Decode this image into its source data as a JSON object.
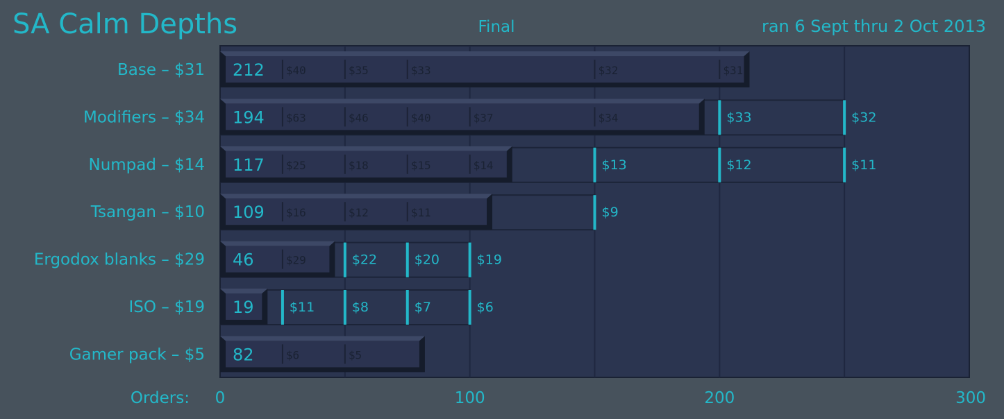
{
  "header": {
    "title": "SA Calm Depths",
    "subtitle": "Final",
    "date_range": "ran 6 Sept thru 2 Oct 2013"
  },
  "colors": {
    "background": "#47525c",
    "plot_background": "#2b3550",
    "accent": "#23b8c9",
    "bar_face": "#2b3350",
    "bar_bevel_top": "#3d4866",
    "bar_shadow": "#151c2b",
    "grid": "#1f2740"
  },
  "chart_data": {
    "type": "bar",
    "orientation": "horizontal",
    "title": "SA Calm Depths",
    "subtitle": "Final",
    "xlabel": "Orders:",
    "xlim": [
      0,
      300
    ],
    "xticks": [
      0,
      100,
      200,
      300
    ],
    "grid": true,
    "categories": [
      "Base – $31",
      "Modifiers – $34",
      "Numpad – $14",
      "Tsangan – $10",
      "Ergodox blanks – $29",
      "ISO – $19",
      "Gamer pack – $5"
    ],
    "values": [
      212,
      194,
      117,
      109,
      46,
      19,
      82
    ],
    "price_tiers": [
      [
        {
          "orders": 25,
          "price": "$40"
        },
        {
          "orders": 50,
          "price": "$35"
        },
        {
          "orders": 75,
          "price": "$33"
        },
        {
          "orders": 150,
          "price": "$32"
        },
        {
          "orders": 200,
          "price": "$31"
        }
      ],
      [
        {
          "orders": 25,
          "price": "$63"
        },
        {
          "orders": 50,
          "price": "$46"
        },
        {
          "orders": 75,
          "price": "$40"
        },
        {
          "orders": 100,
          "price": "$37"
        },
        {
          "orders": 150,
          "price": "$34"
        },
        {
          "orders": 200,
          "price": "$33"
        },
        {
          "orders": 250,
          "price": "$32"
        }
      ],
      [
        {
          "orders": 25,
          "price": "$25"
        },
        {
          "orders": 50,
          "price": "$18"
        },
        {
          "orders": 75,
          "price": "$15"
        },
        {
          "orders": 100,
          "price": "$14"
        },
        {
          "orders": 150,
          "price": "$13"
        },
        {
          "orders": 200,
          "price": "$12"
        },
        {
          "orders": 250,
          "price": "$11"
        }
      ],
      [
        {
          "orders": 25,
          "price": "$16"
        },
        {
          "orders": 50,
          "price": "$12"
        },
        {
          "orders": 75,
          "price": "$11"
        },
        {
          "orders": 150,
          "price": "$9"
        }
      ],
      [
        {
          "orders": 25,
          "price": "$29"
        },
        {
          "orders": 50,
          "price": "$22"
        },
        {
          "orders": 75,
          "price": "$20"
        },
        {
          "orders": 100,
          "price": "$19"
        }
      ],
      [
        {
          "orders": 25,
          "price": "$11"
        },
        {
          "orders": 50,
          "price": "$8"
        },
        {
          "orders": 75,
          "price": "$7"
        },
        {
          "orders": 100,
          "price": "$6"
        }
      ],
      [
        {
          "orders": 25,
          "price": "$6"
        },
        {
          "orders": 50,
          "price": "$5"
        }
      ]
    ],
    "tier_track_max": [
      212,
      250,
      250,
      150,
      100,
      100,
      82
    ]
  }
}
